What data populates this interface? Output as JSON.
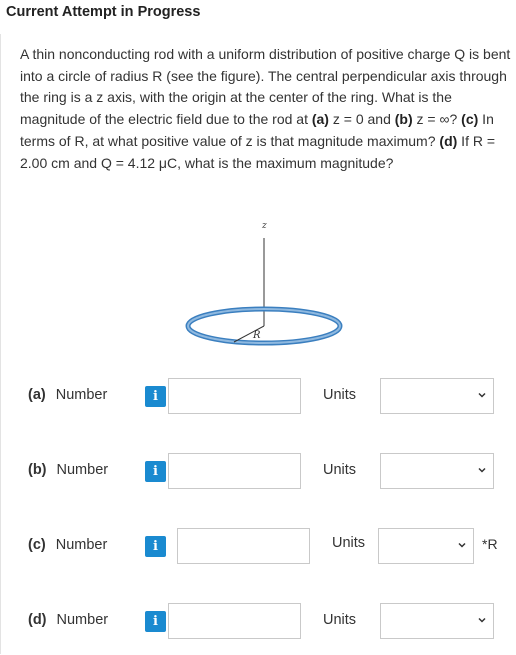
{
  "header": {
    "title": "Current Attempt in Progress"
  },
  "question": {
    "p1": "A thin nonconducting rod with a uniform distribution of positive charge Q is bent into a circle of radius R (see the figure). The central perpendicular axis through the ring is a z axis, with the origin at the center of the ring. What is the magnitude of the electric field due to the rod at ",
    "a_tag": "(a)",
    "a_text": " z = 0 and ",
    "b_tag": "(b)",
    "b_text": " z = ∞? ",
    "c_tag": "(c)",
    "c_text": " In terms of R, at what positive value of z is that magnitude maximum? ",
    "d_tag": "(d)",
    "d_text": " If R = 2.00 cm and Q = 4.12 μC, what is the maximum magnitude?"
  },
  "figure": {
    "z_label": "z",
    "r_label": "R"
  },
  "answers": [
    {
      "part": "(a)",
      "label": "Number",
      "info": "i",
      "units_label": "Units",
      "value": "",
      "unit_value": "",
      "suffix": ""
    },
    {
      "part": "(b)",
      "label": "Number",
      "info": "i",
      "units_label": "Units",
      "value": "",
      "unit_value": "",
      "suffix": ""
    },
    {
      "part": "(c)",
      "label": "Number",
      "info": "i",
      "units_label": "Units",
      "value": "",
      "unit_value": "",
      "suffix": "*R"
    },
    {
      "part": "(d)",
      "label": "Number",
      "info": "i",
      "units_label": "Units",
      "value": "",
      "unit_value": "",
      "suffix": ""
    }
  ],
  "colors": {
    "info_button": "#1a8ad0",
    "ring": "#3b7fbf"
  }
}
